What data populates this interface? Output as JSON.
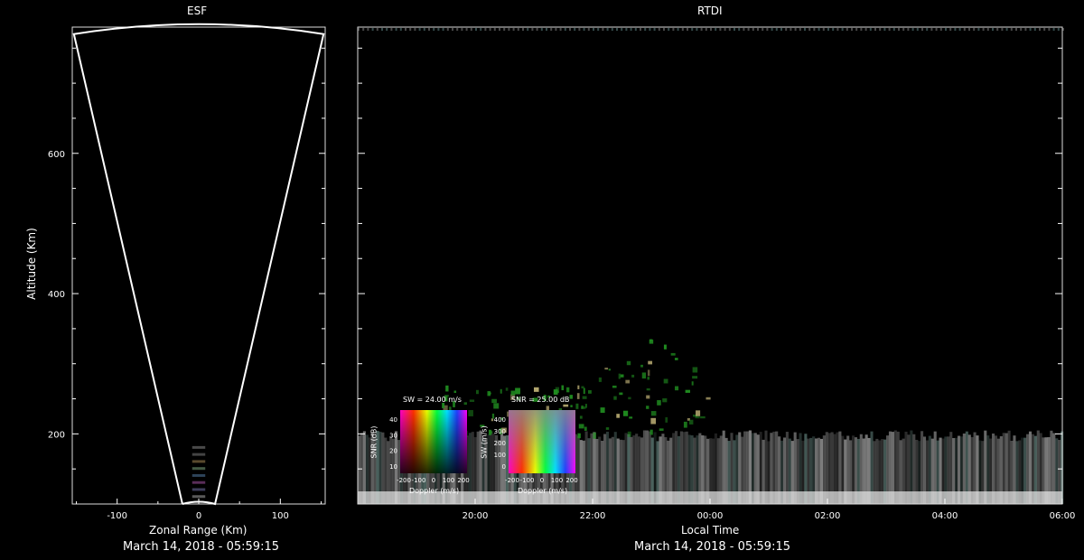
{
  "chart_data": [
    {
      "type": "scatter",
      "title": "ESF",
      "xlabel": "Zonal Range (Km)",
      "ylabel": "Altitude (Km)",
      "xlim": [
        -155,
        155
      ],
      "ylim": [
        100,
        780
      ],
      "x_ticks": [
        "-100",
        "0",
        "100"
      ],
      "y_ticks": [
        "200",
        "400",
        "600"
      ],
      "date_label": "March 14, 2018 - 05:59:15",
      "beam": {
        "left_top_x": -153,
        "right_top_x": 153,
        "top_alt": 770,
        "left_bottom_x": -20,
        "right_bottom_x": 20,
        "bottom_alt": 100
      },
      "echo_altitudes": [
        110,
        120,
        130,
        140,
        150,
        160,
        170,
        180
      ]
    },
    {
      "type": "heatmap",
      "title": "RTDI",
      "xlabel": "Local Time",
      "ylabel": "",
      "x_ticks": [
        "20:00",
        "22:00",
        "00:00",
        "02:00",
        "04:00",
        "06:00"
      ],
      "y_ticks": [
        "200",
        "400",
        "600"
      ],
      "xlim_hours": [
        18.0,
        30.0
      ],
      "ylim": [
        100,
        780
      ],
      "date_label": "March 14, 2018 - 05:59:15",
      "features": [
        {
          "name": "bottomside layer",
          "t_start": 18.0,
          "t_end": 30.0,
          "alt_low": 100,
          "alt_high": 205,
          "color": "#cfcfcf"
        },
        {
          "name": "green plume",
          "t_start": 19.4,
          "t_end": 24.0,
          "alt_low": 200,
          "alt_high": 360,
          "color": "#1f8a1f"
        }
      ]
    }
  ],
  "legends": {
    "sw_panel": {
      "title": "SW = 24.00 m/s",
      "ylabel": "SNR (dB)",
      "xlabel": "Doppler (m/s)",
      "y_ticks": [
        "40",
        "30",
        "20",
        "10"
      ],
      "x_ticks": [
        "-200",
        "-100",
        "0",
        "100",
        "200"
      ]
    },
    "snr_panel": {
      "title": "SNR = 25.00 dB",
      "ylabel": "SW (m/s)",
      "xlabel": "Doppler (m/s)",
      "y_ticks": [
        "400",
        "300",
        "200",
        "100",
        "0"
      ],
      "x_ticks": [
        "-200",
        "-100",
        "0",
        "100",
        "200"
      ]
    }
  }
}
